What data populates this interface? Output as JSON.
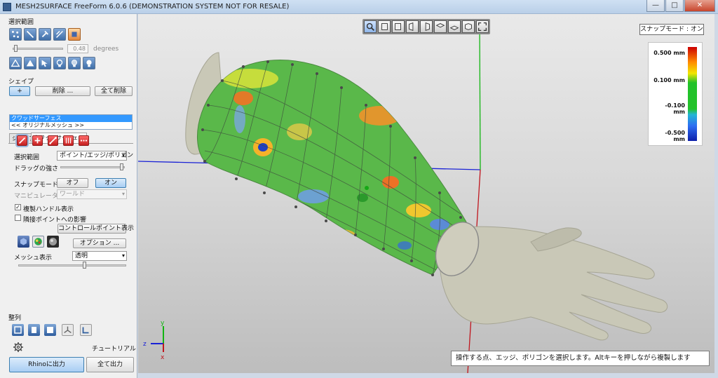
{
  "window": {
    "title": "MESH2SURFACE FreeForm 6.0.6 (DEMONSTRATION SYSTEM NOT FOR RESALE)"
  },
  "panel": {
    "selection_range_title": "選択範囲",
    "degrees_value": "0.48",
    "degrees_unit": "degrees",
    "shape_title": "シェイプ",
    "add_label": "+",
    "delete_label": "削除 ...",
    "delete_all_label": "全て削除",
    "list_items": [
      "クワッドサーフェス",
      "<< オリジナルメッシュ >>"
    ],
    "tabs": [
      "シェイプ",
      "クワッドサーフェス"
    ],
    "selection_range_label": "選択範囲",
    "selection_mode_value": "ポイント/エッジ/ポリゴン",
    "drag_strength_label": "ドラッグの強さ",
    "snap_mode_label": "スナップモード",
    "snap_off_label": "オフ",
    "snap_on_label": "オン",
    "manipulator_label": "マニピュレータ",
    "manipulator_value": "ワールド",
    "show_copy_handles_label": "複製ハンドル表示",
    "affect_neighbors_label": "隣接ポイントへの影響",
    "show_control_points_label": "コントロールポイント表示",
    "options_label": "オプション ...",
    "mesh_display_label": "メッシュ表示",
    "mesh_display_value": "透明",
    "align_title": "整列",
    "tutorial_label": "チュートリアル",
    "export_rhino_label": "Rhinoに出力",
    "export_all_label": "全て出力",
    "show_copy_handles_checked": true,
    "affect_neighbors_checked": false
  },
  "viewport": {
    "snap_mode_status": "スナップモード : オン",
    "legend_values": [
      "0.500 mm",
      "0.100 mm",
      "-0.100 mm",
      "-0.500 mm"
    ],
    "axis_labels": {
      "y": "y",
      "z": "z",
      "x": "x"
    },
    "status_message": "操作する点、エッジ、ポリゴンを選択します。Altキーを押しながら複製します",
    "colors": {
      "mesh_green": "#5ab84a",
      "hand": "#c9c8b7",
      "axis_blue": "#1a22d6",
      "axis_green": "#12b512",
      "axis_red": "#c0161e"
    }
  }
}
